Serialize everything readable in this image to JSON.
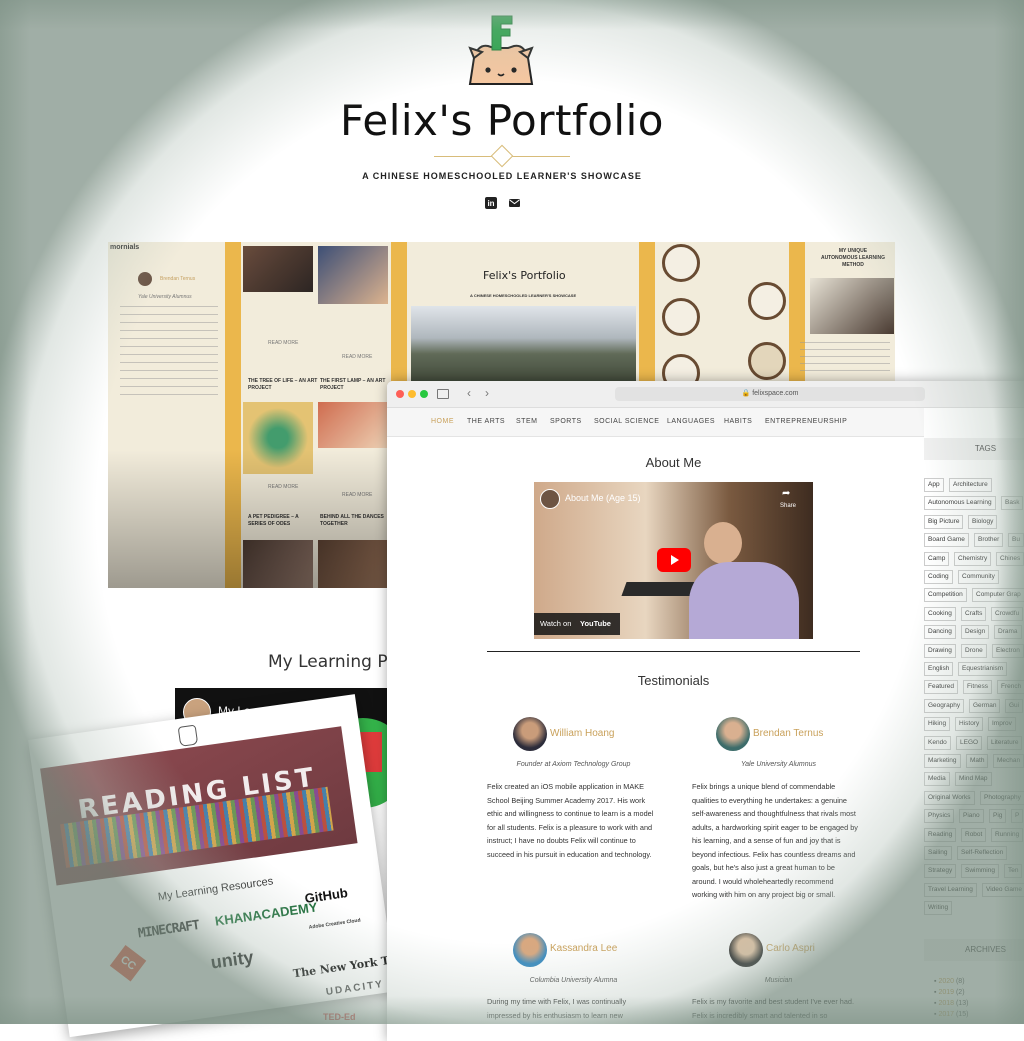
{
  "site": {
    "title": "Felix's Portfolio",
    "tagline": "A CHINESE HOMESCHOOLED LEARNER'S SHOWCASE",
    "social": [
      {
        "icon": "linkedin-icon",
        "label": "in"
      },
      {
        "icon": "mail-icon",
        "label": ""
      }
    ]
  },
  "background_collage": {
    "mini_title": "Felix's Portfolio",
    "mini_tagline": "A CHINESE HOMESCHOOLED LEARNER'S SHOWCASE",
    "side_text": "mornials",
    "mini_name": "Brendan Ternus",
    "mini_role": "Yale University Alumnus",
    "right_heading": "MY UNIQUE AUTONOMOUS LEARNING METHOD",
    "read_more": "READ MORE",
    "post_titles": [
      "THE TREE OF LIFE – AN ART PROJECT",
      "THE FIRST LAMP – AN ART PROJECT",
      "A PET PEDIGREE – A SERIES OF ODES",
      "BEHIND ALL THE DANCES TOGETHER"
    ]
  },
  "learning_philosophy": {
    "heading": "My Learning P",
    "video_title": "My Learning Philosophy"
  },
  "reading_list": {
    "banner_title": "READING LIST",
    "subtitle": "My Learning Resources",
    "resources": [
      "MINECRAFT",
      "KHANACADEMY",
      "GitHub",
      "Adobe Creative Cloud",
      "unity",
      "The New York Times",
      "UDACITY",
      "TED-Ed",
      "CC"
    ]
  },
  "browser": {
    "url": "felixspace.com",
    "nav": [
      "HOME",
      "THE ARTS",
      "STEM",
      "SPORTS",
      "SOCIAL SCIENCE",
      "LANGUAGES",
      "HABITS",
      "ENTREPRENEURSHIP"
    ],
    "active_nav": "HOME",
    "about_heading": "About Me",
    "video": {
      "title": "About Me (Age 15)",
      "share": "Share",
      "watch_on": "Watch on",
      "platform": "YouTube"
    },
    "testimonials_heading": "Testimonials",
    "testimonials": [
      {
        "name": "William Hoang",
        "role": "Founder at Axiom Technology Group",
        "body": "Felix created an iOS mobile application in MAKE School Beijing Summer Academy 2017. His work ethic and willingness to continue to learn is a model for all students. Felix is a pleasure to work with and instruct; I have no doubts Felix will continue to succeed in his pursuit in education and technology."
      },
      {
        "name": "Brendan Ternus",
        "role": "Yale University Alumnus",
        "body": "Felix brings a unique blend of commendable qualities to everything he undertakes: a genuine self-awareness and thoughtfulness that rivals most adults, a hardworking spirit eager to be engaged by his learning, and a sense of fun and joy that is beyond infectious. Felix has countless dreams and goals, but he's also just a great human to be around. I would wholeheartedly recommend working with him on any project big or small."
      },
      {
        "name": "Kassandra Lee",
        "role": "Columbia University Alumna",
        "body": "During my time with Felix, I was continually impressed by his enthusiasm to learn new"
      },
      {
        "name": "Carlo Aspri",
        "role": "Musician",
        "body": "Felix is my favorite and best student I've ever had. Felix is incredibly smart and talented in so"
      }
    ],
    "sidebar": {
      "tags_heading": "TAGS",
      "tags": [
        [
          "App",
          "Architecture"
        ],
        [
          "Autonomous Learning",
          "Bask"
        ],
        [
          "Big Picture",
          "Biology"
        ],
        [
          "Board Game",
          "Brother",
          "Bu"
        ],
        [
          "Camp",
          "Chemistry",
          "Chines"
        ],
        [
          "Coding",
          "Community"
        ],
        [
          "Competition",
          "Computer Grap"
        ],
        [
          "Cooking",
          "Crafts",
          "Crowdfu"
        ],
        [
          "Dancing",
          "Design",
          "Drama"
        ],
        [
          "Drawing",
          "Drone",
          "Electron"
        ],
        [
          "English",
          "Equestrianism"
        ],
        [
          "Featured",
          "Fitness",
          "French"
        ],
        [
          "Geography",
          "German",
          "Gui"
        ],
        [
          "Hiking",
          "History",
          "Improv"
        ],
        [
          "Kendo",
          "LEGO",
          "Literature"
        ],
        [
          "Marketing",
          "Math",
          "Mechan"
        ],
        [
          "Media",
          "Mind Map"
        ],
        [
          "Original Works",
          "Photography"
        ],
        [
          "Physics",
          "Piano",
          "Pig",
          "P"
        ],
        [
          "Reading",
          "Robot",
          "Running"
        ],
        [
          "Sailing",
          "Self-Reflection"
        ],
        [
          "Strategy",
          "Swimming",
          "Ten"
        ],
        [
          "Travel Learning",
          "Video Game"
        ],
        [
          "Writing"
        ]
      ],
      "archives_heading": "ARCHIVES",
      "archives": [
        {
          "year": "2020",
          "count": "(8)"
        },
        {
          "year": "2019",
          "count": "(2)"
        },
        {
          "year": "2018",
          "count": "(13)"
        },
        {
          "year": "2017",
          "count": "(15)"
        }
      ]
    }
  },
  "colors": {
    "accent": "#c9a15b",
    "nav_bg": "#f6f6f6",
    "youtube_red": "#ff0000",
    "collage_yellow": "#f0b740"
  }
}
